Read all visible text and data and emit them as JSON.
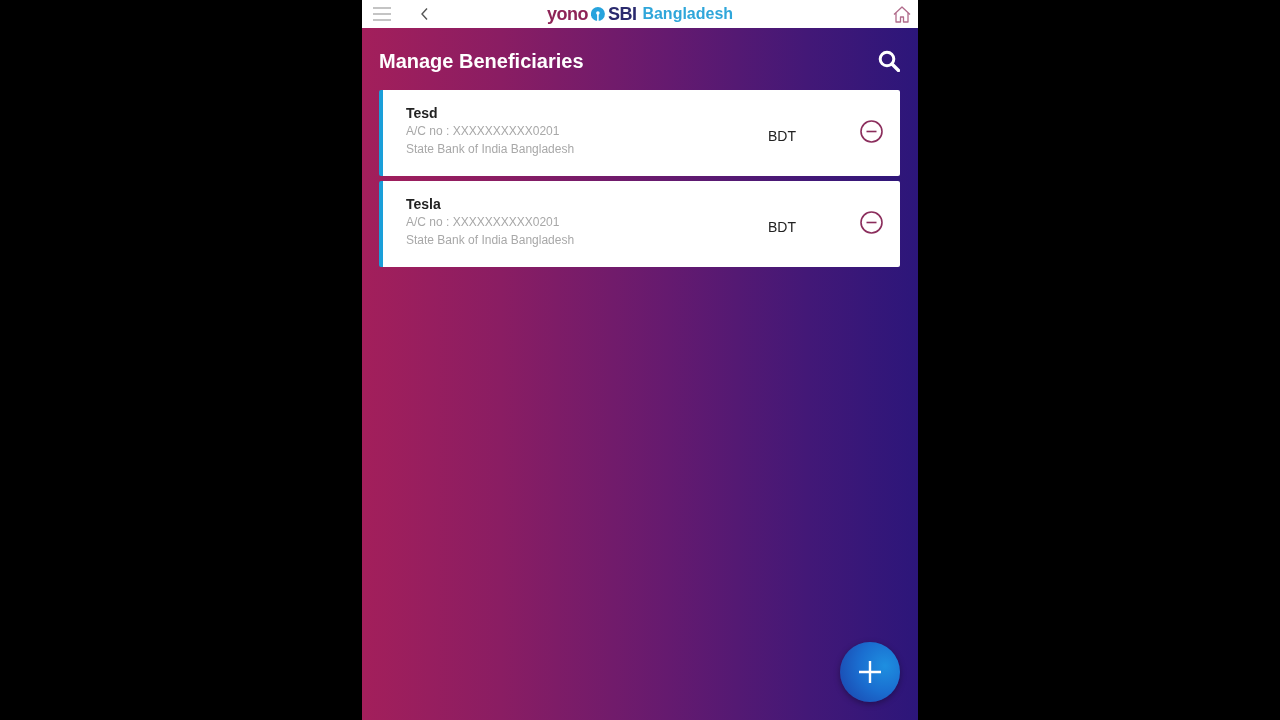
{
  "top_bar": {
    "logo": {
      "brand": "yono",
      "bank": "SBI",
      "region": "Bangladesh"
    }
  },
  "page": {
    "title": "Manage Beneficiaries"
  },
  "beneficiaries": [
    {
      "name": "Tesd",
      "account": "A/C no : XXXXXXXXXX0201",
      "bank": "State Bank of India Bangladesh",
      "currency": "BDT"
    },
    {
      "name": "Tesla",
      "account": "A/C no : XXXXXXXXXX0201",
      "bank": "State Bank of India Bangladesh",
      "currency": "BDT"
    }
  ]
}
